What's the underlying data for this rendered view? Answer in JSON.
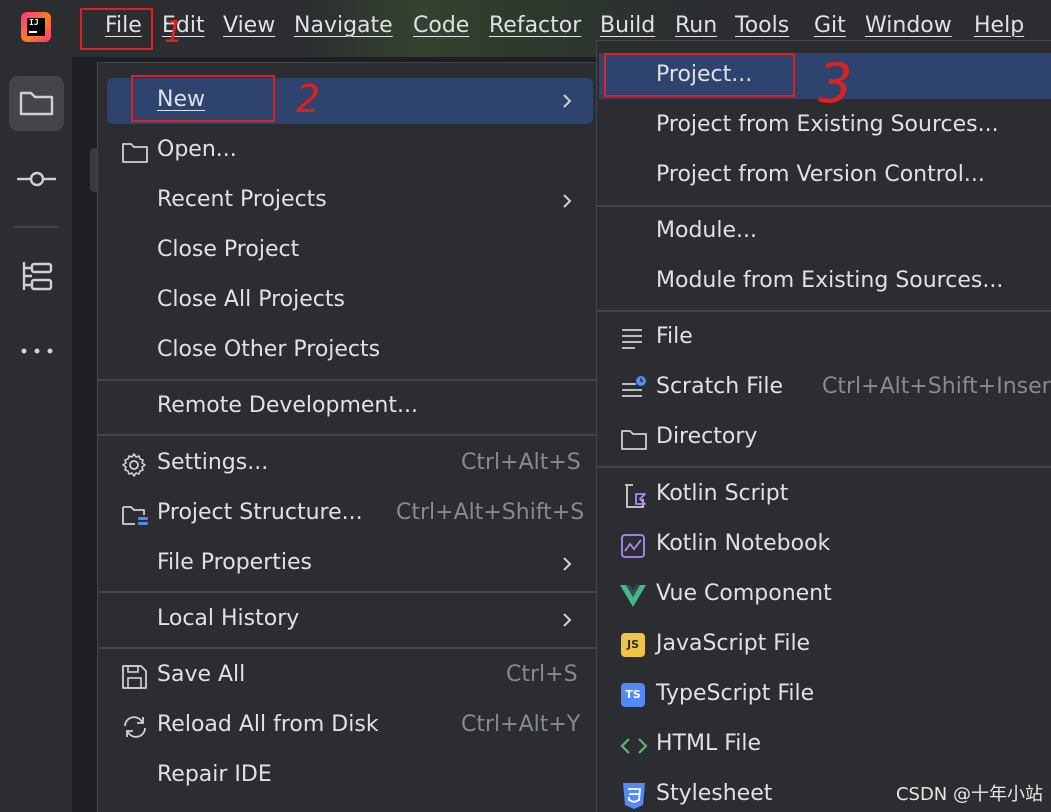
{
  "menubar": {
    "items": [
      {
        "label": "File",
        "mnemonic": "F"
      },
      {
        "label": "Edit"
      },
      {
        "label": "View"
      },
      {
        "label": "Navigate"
      },
      {
        "label": "Code"
      },
      {
        "label": "Refactor"
      },
      {
        "label": "Build"
      },
      {
        "label": "Run"
      },
      {
        "label": "Tools"
      },
      {
        "label": "Git"
      },
      {
        "label": "Window"
      },
      {
        "label": "Help"
      }
    ],
    "logo_text": "IJ"
  },
  "file_menu": {
    "items": [
      {
        "label": "New",
        "has_submenu": true,
        "selected": true
      },
      {
        "label": "Open..."
      },
      {
        "label": "Recent Projects",
        "has_submenu": true
      },
      {
        "label": "Close Project"
      },
      {
        "label": "Close All Projects"
      },
      {
        "label": "Close Other Projects"
      },
      {
        "label": "Remote Development..."
      },
      {
        "label": "Settings...",
        "shortcut": "Ctrl+Alt+S"
      },
      {
        "label": "Project Structure...",
        "shortcut": "Ctrl+Alt+Shift+S"
      },
      {
        "label": "File Properties",
        "has_submenu": true
      },
      {
        "label": "Local History",
        "has_submenu": true
      },
      {
        "label": "Save All",
        "shortcut": "Ctrl+S"
      },
      {
        "label": "Reload All from Disk",
        "shortcut": "Ctrl+Alt+Y"
      },
      {
        "label": "Repair IDE"
      }
    ]
  },
  "new_submenu": {
    "items": [
      {
        "label": "Project...",
        "selected": true
      },
      {
        "label": "Project from Existing Sources..."
      },
      {
        "label": "Project from Version Control..."
      },
      {
        "label": "Module..."
      },
      {
        "label": "Module from Existing Sources..."
      },
      {
        "label": "File"
      },
      {
        "label": "Scratch File",
        "shortcut": "Ctrl+Alt+Shift+Insert"
      },
      {
        "label": "Directory"
      },
      {
        "label": "Kotlin Script"
      },
      {
        "label": "Kotlin Notebook"
      },
      {
        "label": "Vue Component"
      },
      {
        "label": "JavaScript File",
        "badge": "JS"
      },
      {
        "label": "TypeScript File",
        "badge": "TS"
      },
      {
        "label": "HTML File"
      },
      {
        "label": "Stylesheet"
      }
    ]
  },
  "annotations": {
    "step1": "1",
    "step2": "2",
    "step3": "3",
    "color": "#e02020"
  },
  "watermark": "CSDN @十年小站",
  "colors": {
    "menu_bg": "#2b2d30",
    "selection": "#2e436e",
    "text": "#dfe1e5",
    "shortcut_text": "#868a91",
    "border": "#43454a"
  }
}
